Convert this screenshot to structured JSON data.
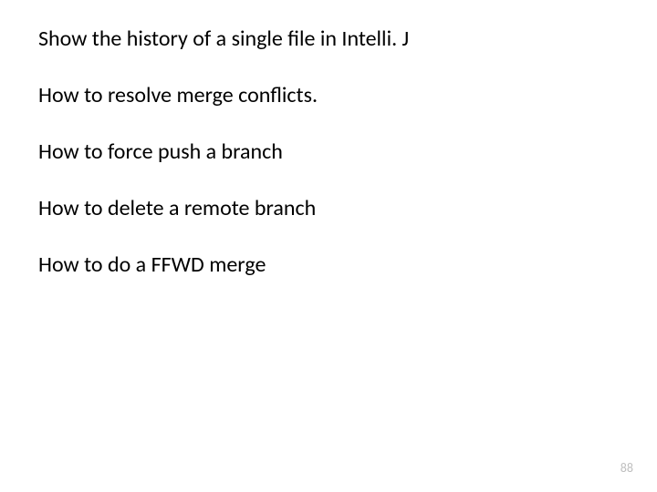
{
  "lines": [
    "Show the history of a single file in Intelli. J",
    "How to resolve merge conflicts.",
    "How to force push a branch",
    "How to delete a remote branch",
    "How to do a FFWD merge"
  ],
  "page_number": "88"
}
